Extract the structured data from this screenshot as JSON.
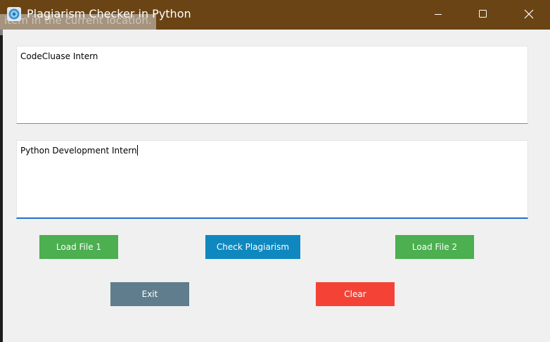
{
  "window": {
    "title": "Plagiarism Checker in Python",
    "icon": "python-idle-icon",
    "background_tooltip_text": "item in the current location.",
    "controls": {
      "minimize": "minimize-icon",
      "maximize": "maximize-icon",
      "close": "close-icon"
    },
    "titlebar_color": "#6a4414"
  },
  "inputs": {
    "text1": "CodeCluase Intern",
    "text2": "Python Development Intern"
  },
  "buttons": {
    "load_file_1": "Load File 1",
    "check_plagiarism": "Check Plagiarism",
    "load_file_2": "Load File 2",
    "exit": "Exit",
    "clear": "Clear"
  },
  "colors": {
    "load_button": "#4caf50",
    "check_button": "#0e88bf",
    "exit_button": "#5f7d8c",
    "clear_button": "#f44336",
    "focus_border": "#1f6fd1"
  }
}
